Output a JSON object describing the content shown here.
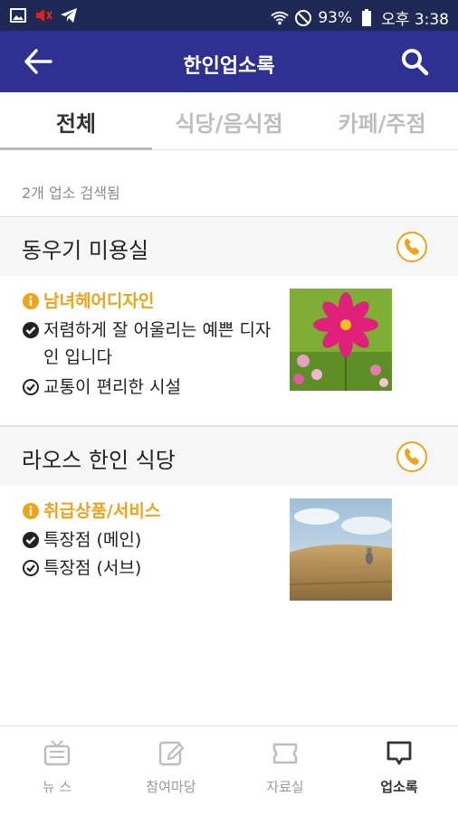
{
  "status_bar": {
    "battery": "93%",
    "time": "오후 3:38"
  },
  "app_bar": {
    "title": "한인업소록"
  },
  "tabs": [
    {
      "label": "전체"
    },
    {
      "label": "식당/음식점"
    },
    {
      "label": "카페/주점"
    }
  ],
  "result_count": "2개 업소 검색됨",
  "listings": [
    {
      "name": "동우기 미용실",
      "category": "남녀헤어디자인",
      "features": [
        "저렴하게 잘 어울리는 예쁜 디자인 입니다",
        "교통이 편리한 시설"
      ]
    },
    {
      "name": "라오스 한인 식당",
      "category": "취급상품/서비스",
      "features": [
        "특장점 (메인)",
        "특장점 (서브)"
      ]
    }
  ],
  "bottom_nav": [
    {
      "label": "뉴 스",
      "icon": "tv-icon"
    },
    {
      "label": "참여마당",
      "icon": "edit-icon"
    },
    {
      "label": "자료실",
      "icon": "ticket-icon"
    },
    {
      "label": "업소록",
      "icon": "chat-icon"
    }
  ],
  "colors": {
    "status_bg": "#1e2a55",
    "app_bar": "#2e3192",
    "accent": "#f0a31a"
  }
}
